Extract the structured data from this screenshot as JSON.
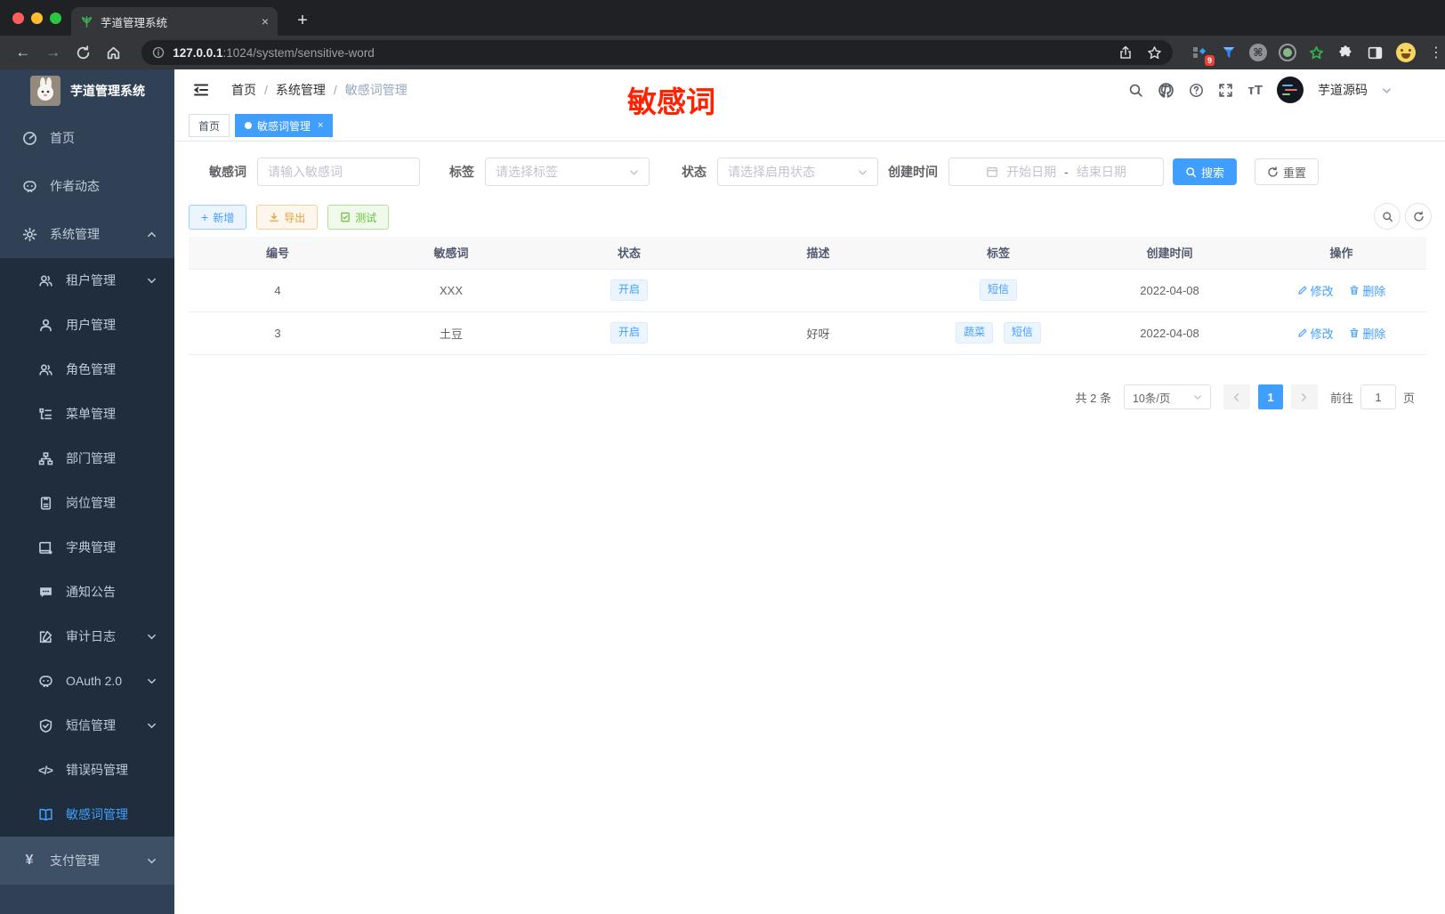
{
  "browser": {
    "tab_title": "芋道管理系统",
    "url_host": "127.0.0.1",
    "url_path": ":1024/system/sensitive-word",
    "ext_badge": "9"
  },
  "icons": {
    "plus": "+",
    "close": "×",
    "dot_char": "⋮",
    "cmd": "⌘",
    "back": "←",
    "forward": "→",
    "code": "</>",
    "yen": "¥",
    "font_size": "тT"
  },
  "header": {
    "breadcrumb": [
      "首页",
      "系统管理",
      "敏感词管理"
    ],
    "separator": "/",
    "username": "芋道源码",
    "annotation": "敏感词"
  },
  "sidebar": {
    "app_title": "芋道管理系统",
    "items": [
      "首页",
      "作者动态",
      "系统管理",
      "租户管理",
      "用户管理",
      "角色管理",
      "菜单管理",
      "部门管理",
      "岗位管理",
      "字典管理",
      "通知公告",
      "审计日志",
      "OAuth 2.0",
      "短信管理",
      "错误码管理",
      "敏感词管理",
      "支付管理"
    ]
  },
  "tabs": {
    "home": "首页",
    "active": "敏感词管理"
  },
  "filters": {
    "keyword_label": "敏感词",
    "keyword_placeholder": "请输入敏感词",
    "tag_label": "标签",
    "tag_placeholder": "请选择标签",
    "status_label": "状态",
    "status_placeholder": "请选择启用状态",
    "date_label": "创建时间",
    "date_start_placeholder": "开始日期",
    "date_separator": "-",
    "date_end_placeholder": "结束日期",
    "search_button": "搜索",
    "reset_button": "重置"
  },
  "toolbar": {
    "add": "新增",
    "export": "导出",
    "test": "测试"
  },
  "table": {
    "columns": [
      "编号",
      "敏感词",
      "状态",
      "描述",
      "标签",
      "创建时间",
      "操作"
    ],
    "rows": [
      {
        "id": "4",
        "word": "XXX",
        "status": "开启",
        "description": "",
        "tags": [
          "短信"
        ],
        "created": "2022-04-08",
        "edit": "修改",
        "delete": "删除"
      },
      {
        "id": "3",
        "word": "土豆",
        "status": "开启",
        "description": "好呀",
        "tags": [
          "蔬菜",
          "短信"
        ],
        "created": "2022-04-08",
        "edit": "修改",
        "delete": "删除"
      }
    ]
  },
  "pagination": {
    "total": "共 2 条",
    "size": "10条/页",
    "page": "1",
    "goto": "前往",
    "goto_value": "1",
    "unit": "页"
  }
}
